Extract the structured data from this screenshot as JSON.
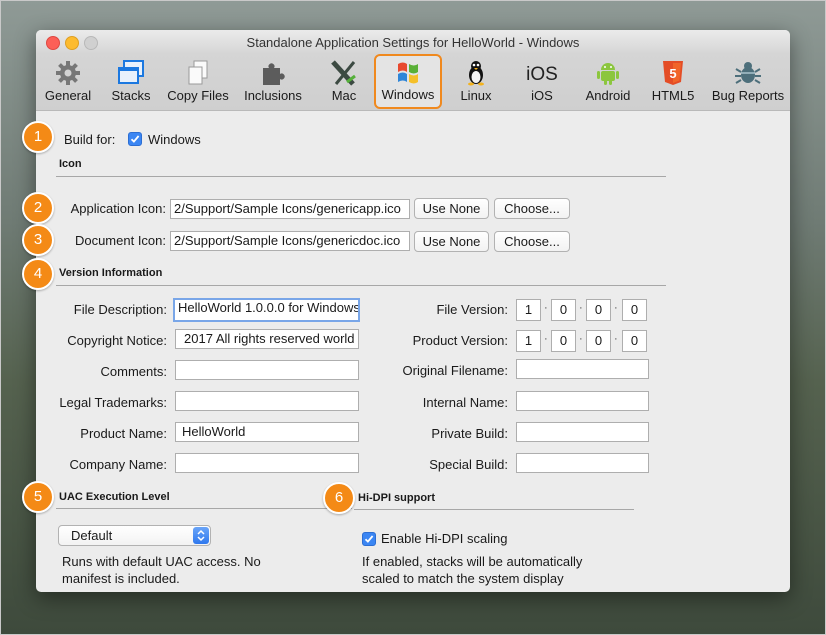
{
  "window": {
    "title": "Standalone Application Settings for HelloWorld - Windows"
  },
  "toolbar": {
    "items": [
      {
        "label": "General",
        "icon": "gear-icon"
      },
      {
        "label": "Stacks",
        "icon": "stacks-icon"
      },
      {
        "label": "Copy Files",
        "icon": "copy-files-icon"
      },
      {
        "label": "Inclusions",
        "icon": "puzzle-icon"
      },
      {
        "label": "Mac",
        "icon": "mac-x-icon"
      },
      {
        "label": "Windows",
        "icon": "windows-icon",
        "selected": true
      },
      {
        "label": "Linux",
        "icon": "linux-penguin-icon"
      },
      {
        "label": "iOS",
        "icon": "ios-icon"
      },
      {
        "label": "Android",
        "icon": "android-icon"
      },
      {
        "label": "HTML5",
        "icon": "html5-icon"
      },
      {
        "label": "Bug Reports",
        "icon": "bug-icon"
      }
    ]
  },
  "badges": [
    "1",
    "2",
    "3",
    "4",
    "5",
    "6"
  ],
  "build": {
    "label": "Build for:",
    "checkbox_label": "Windows",
    "checked": true
  },
  "icon_section": {
    "title": "Icon",
    "app_icon_label": "Application Icon:",
    "app_icon_value": "2/Support/Sample Icons/genericapp.ico",
    "doc_icon_label": "Document Icon:",
    "doc_icon_value": "2/Support/Sample Icons/genericdoc.ico",
    "use_none": "Use None",
    "choose": "Choose..."
  },
  "version_section": {
    "title": "Version Information",
    "left_fields": [
      {
        "label": "File Description:",
        "value": "HelloWorld 1.0.0.0 for Windows"
      },
      {
        "label": "Copyright Notice:",
        "value": "2017  All rights reserved world"
      },
      {
        "label": "Comments:",
        "value": ""
      },
      {
        "label": "Legal Trademarks:",
        "value": ""
      },
      {
        "label": "Product Name:",
        "value": "HelloWorld"
      },
      {
        "label": "Company Name:",
        "value": ""
      }
    ],
    "file_version_label": "File Version:",
    "file_version": [
      "1",
      "0",
      "0",
      "0"
    ],
    "product_version_label": "Product Version:",
    "product_version": [
      "1",
      "0",
      "0",
      "0"
    ],
    "right_fields": [
      {
        "label": "Original Filename:",
        "value": ""
      },
      {
        "label": "Internal Name:",
        "value": ""
      },
      {
        "label": "Private Build:",
        "value": ""
      },
      {
        "label": "Special Build:",
        "value": ""
      }
    ]
  },
  "uac": {
    "title": "UAC Execution Level",
    "selected": "Default",
    "desc_line1": "Runs with default UAC access. No",
    "desc_line2": "manifest is included."
  },
  "hidpi": {
    "title": "Hi-DPI support",
    "checkbox_label": "Enable Hi-DPI scaling",
    "checked": true,
    "desc_line1": "If enabled, stacks will be automatically",
    "desc_line2": "scaled to match the system display"
  },
  "colors": {
    "accent": "#f48a16",
    "selection_blue": "#3b86f3"
  }
}
